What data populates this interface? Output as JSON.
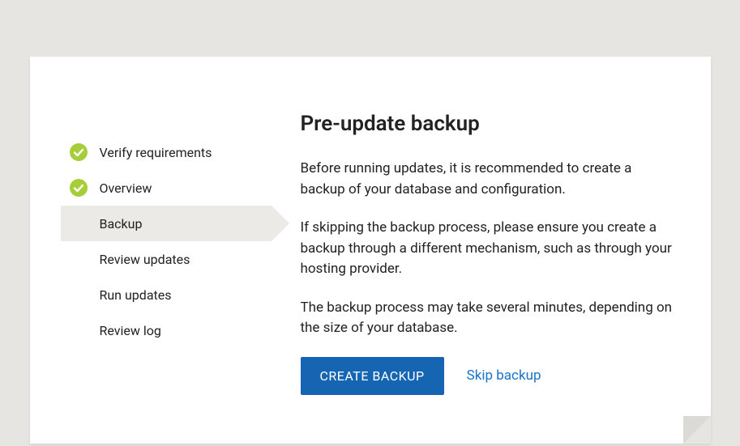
{
  "sidebar": {
    "items": [
      {
        "label": "Verify requirements",
        "state": "done"
      },
      {
        "label": "Overview",
        "state": "done"
      },
      {
        "label": "Backup",
        "state": "current"
      },
      {
        "label": "Review updates",
        "state": "upcoming"
      },
      {
        "label": "Run updates",
        "state": "upcoming"
      },
      {
        "label": "Review log",
        "state": "upcoming"
      }
    ]
  },
  "content": {
    "title": "Pre-update backup",
    "paragraphs": [
      "Before running updates, it is recommended to create a backup of your database and configuration.",
      "If skipping the backup process, please ensure you create a backup through a different mechanism, such as through your hosting provider.",
      "The backup process may take several minutes, depending on the size of your database."
    ],
    "primary_button": "CREATE BACKUP",
    "skip_link": "Skip backup"
  },
  "colors": {
    "accent_green": "#a6ce39",
    "primary_blue": "#1565b3",
    "link_blue": "#1a73c7"
  }
}
